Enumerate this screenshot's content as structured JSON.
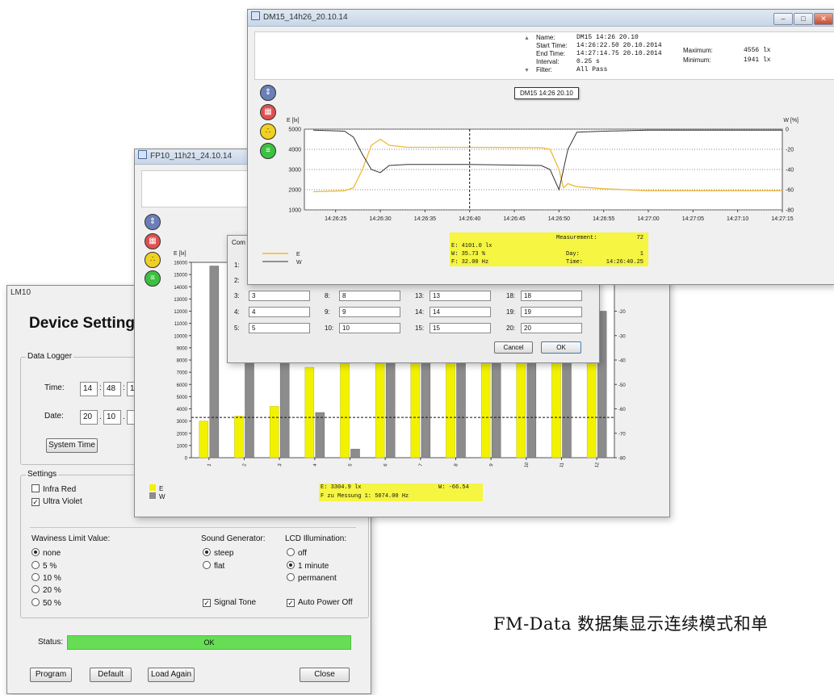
{
  "lm10": {
    "title": "LM10",
    "heading": "Device Setting",
    "data_logger": {
      "title": "Data Logger",
      "time_label": "Time:",
      "time": [
        "14",
        "48",
        "1"
      ],
      "date_label": "Date:",
      "date": [
        "20",
        "10",
        ""
      ],
      "system_time_button": "System Time"
    },
    "settings": {
      "title": "Settings",
      "infra_red": "Infra Red",
      "ultra_violet": "Ultra Violet"
    },
    "waviness": {
      "title": "Waviness Limit Value:",
      "options": [
        "none",
        "5 %",
        "10 %",
        "20 %",
        "50 %"
      ],
      "selected": "none"
    },
    "sound": {
      "title": "Sound Generator:",
      "options": [
        "steep",
        "flat"
      ],
      "selected": "steep",
      "signal_tone": "Signal Tone"
    },
    "lcd": {
      "title": "LCD Illumination:",
      "options": [
        "off",
        "1 minute",
        "permanent"
      ],
      "selected": "1 minute",
      "auto_power_off": "Auto Power Off"
    },
    "status_label": "Status:",
    "status_value": "OK",
    "buttons": {
      "program": "Program",
      "default": "Default",
      "load_again": "Load Again",
      "close": "Close"
    },
    "colors": {
      "status_ok": "#66dd55"
    }
  },
  "fp10": {
    "title": "FP10_11h21_24.10.14",
    "y_left_label": "E [lx]",
    "legend": [
      "E",
      "W"
    ],
    "readout_line1": "E:  3304.9 lx",
    "readout_w": "W:  -66.54",
    "readout_line2": "F zu Messung  1: 5074.00 Hz",
    "colors": {
      "E": "#f2f200",
      "W": "#8c8c8c",
      "readout_bg": "#f5f542"
    },
    "chart_data": {
      "type": "bar",
      "categories": [
        "1",
        "2",
        "3",
        "4",
        "5",
        "6",
        "7",
        "8",
        "9",
        "10",
        "11",
        "12"
      ],
      "series": [
        {
          "name": "E",
          "values": [
            3000,
            3400,
            4200,
            7400,
            15000,
            15000,
            15000,
            15000,
            15000,
            15000,
            15000,
            15000
          ]
        },
        {
          "name": "W",
          "values": [
            15700,
            15000,
            15000,
            3700,
            700,
            15000,
            15000,
            15000,
            15000,
            15000,
            15000,
            12000
          ]
        }
      ],
      "y_ticks": [
        "0",
        "1000",
        "2000",
        "3000",
        "4000",
        "5000",
        "6000",
        "7000",
        "8000",
        "9000",
        "10000",
        "11000",
        "12000",
        "13000",
        "14000",
        "15000",
        "16000"
      ],
      "y2_ticks": [
        "-20",
        "-30",
        "-40",
        "-50",
        "-60",
        "-70",
        "-80"
      ],
      "ylim": [
        0,
        16000
      ],
      "y2lim": [
        -80,
        0
      ],
      "xlabel": "",
      "ylabel": "E [lx]"
    }
  },
  "dialog": {
    "title": "Com",
    "fields": [
      {
        "label": "1:",
        "value": ""
      },
      {
        "label": "2:",
        "value": ""
      },
      {
        "label": "3:",
        "value": "3"
      },
      {
        "label": "4:",
        "value": "4"
      },
      {
        "label": "5:",
        "value": "5"
      },
      {
        "label": "8:",
        "value": "8"
      },
      {
        "label": "9:",
        "value": "9"
      },
      {
        "label": "10:",
        "value": "10"
      },
      {
        "label": "13:",
        "value": "13"
      },
      {
        "label": "14:",
        "value": "14"
      },
      {
        "label": "15:",
        "value": "15"
      },
      {
        "label": "18:",
        "value": "18"
      },
      {
        "label": "19:",
        "value": "19"
      },
      {
        "label": "20:",
        "value": "20"
      }
    ],
    "cancel": "Cancel",
    "ok": "OK"
  },
  "dm15": {
    "title": "DM15_14h26_20.10.14",
    "info": {
      "name_label": "Name:",
      "name": "DM15 14:26 20.10",
      "start_label": "Start Time:",
      "start": "14:26:22.50  20.10.2014",
      "end_label": "End Time:",
      "end": "14:27:14.75  20.10.2014",
      "interval_label": "Interval:",
      "interval": "0.25 s",
      "filter_label": "Filter:",
      "filter": "All Pass",
      "max_label": "Maximum:",
      "max": "4556 lx",
      "min_label": "Minimum:",
      "min": "1941 lx"
    },
    "chart_title": "DM15 14:26 20.10",
    "y_left_label": "E [lx]",
    "y_right_label": "W [%]",
    "legend": [
      "E",
      "W"
    ],
    "readout": {
      "measurement_label": "Measurement:",
      "measurement": "72",
      "e": "E:  4101.0 lx",
      "w": "W:   35.73 %",
      "day_label": "Day:",
      "day": "1",
      "f": "F:  32.00 Hz",
      "time_label": "Time:",
      "time": "14:26:40.25"
    },
    "colors": {
      "E": "#f0b838",
      "W": "#333333",
      "readout_bg": "#f5f542"
    },
    "chart_data": {
      "type": "line",
      "x_ticks": [
        "14:26:25",
        "14:26:30",
        "14:26:35",
        "14:26:40",
        "14:26:45",
        "14:26:50",
        "14:26:55",
        "14:27:00",
        "14:27:05",
        "14:27:10",
        "14:27:15"
      ],
      "y_ticks": [
        "1000",
        "2000",
        "3000",
        "4000",
        "5000"
      ],
      "y2_ticks": [
        "0",
        "-20",
        "-40",
        "-60",
        "-80"
      ],
      "ylim": [
        1000,
        5000
      ],
      "y2lim": [
        -80,
        0
      ],
      "cursor_x": "14:26:40",
      "series": [
        {
          "name": "E",
          "points": [
            [
              "14:26:22.5",
              1900
            ],
            [
              "14:26:26",
              1950
            ],
            [
              "14:26:27",
              2100
            ],
            [
              "14:26:28",
              3000
            ],
            [
              "14:26:29",
              4200
            ],
            [
              "14:26:30",
              4500
            ],
            [
              "14:26:31",
              4200
            ],
            [
              "14:26:33",
              4100
            ],
            [
              "14:26:40",
              4100
            ],
            [
              "14:26:48",
              4080
            ],
            [
              "14:26:49",
              4000
            ],
            [
              "14:26:50",
              3000
            ],
            [
              "14:26:50.5",
              2100
            ],
            [
              "14:26:51",
              2300
            ],
            [
              "14:26:52",
              2150
            ],
            [
              "14:26:55",
              2050
            ],
            [
              "14:27:00",
              1950
            ],
            [
              "14:27:15",
              1950
            ]
          ]
        },
        {
          "name": "W",
          "points": [
            [
              "14:26:22.5",
              -1
            ],
            [
              "14:26:26",
              -2
            ],
            [
              "14:26:27",
              -8
            ],
            [
              "14:26:28",
              -25
            ],
            [
              "14:26:29",
              -40
            ],
            [
              "14:26:30",
              -43
            ],
            [
              "14:26:31",
              -36
            ],
            [
              "14:26:33",
              -35
            ],
            [
              "14:26:40",
              -35
            ],
            [
              "14:26:48",
              -36
            ],
            [
              "14:26:49",
              -40
            ],
            [
              "14:26:50",
              -60
            ],
            [
              "14:26:51",
              -20
            ],
            [
              "14:26:52",
              -3
            ],
            [
              "14:26:55",
              -2
            ],
            [
              "14:27:00",
              -1
            ],
            [
              "14:27:15",
              -1
            ]
          ]
        }
      ]
    }
  },
  "caption": "FM-Data 数据集显示连续模式和单"
}
